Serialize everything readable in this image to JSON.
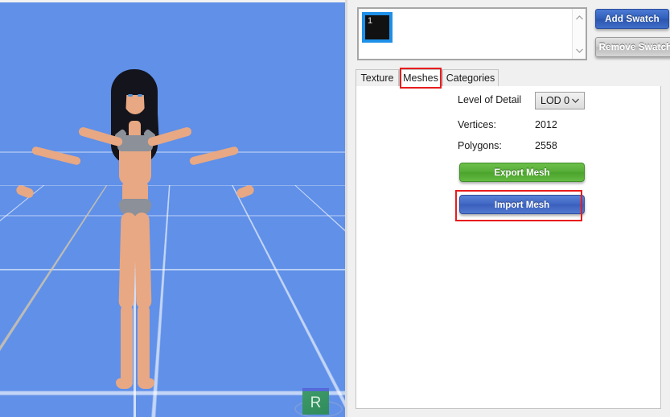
{
  "viewport": {
    "name": "3d-model-preview",
    "background_color": "#6090e8",
    "grid_color": "#ffffff",
    "gizmo_label": "R"
  },
  "swatches": {
    "items": [
      {
        "label": "1",
        "color": "#111111",
        "selected": true
      }
    ],
    "scroll_up_icon": "chevron-up-icon",
    "scroll_down_icon": "chevron-down-icon"
  },
  "toolbar": {
    "add_swatch_label": "Add Swatch",
    "remove_swatch_label": "Remove Swatch",
    "add_swatch_color": "#3060bd",
    "remove_swatch_color": "#c9c9c9"
  },
  "tabs": [
    {
      "label": "Texture",
      "active": false
    },
    {
      "label": "Meshes",
      "active": true
    },
    {
      "label": "Categories",
      "active": false
    }
  ],
  "meshes_pane": {
    "lod_label": "Level of Detail",
    "lod_value": "LOD 0",
    "lod_chevron_icon": "chevron-down-icon",
    "vertices_label": "Vertices:",
    "vertices_value": "2012",
    "polygons_label": "Polygons:",
    "polygons_value": "2558",
    "export_label": "Export Mesh",
    "import_label": "Import Mesh",
    "export_color": "#55ad36",
    "import_color": "#3f66c4"
  },
  "annotations": {
    "highlight_color": "#e81c1c",
    "meshes_tab_highlight": "Meshes",
    "import_button_highlight": "Import Mesh"
  }
}
